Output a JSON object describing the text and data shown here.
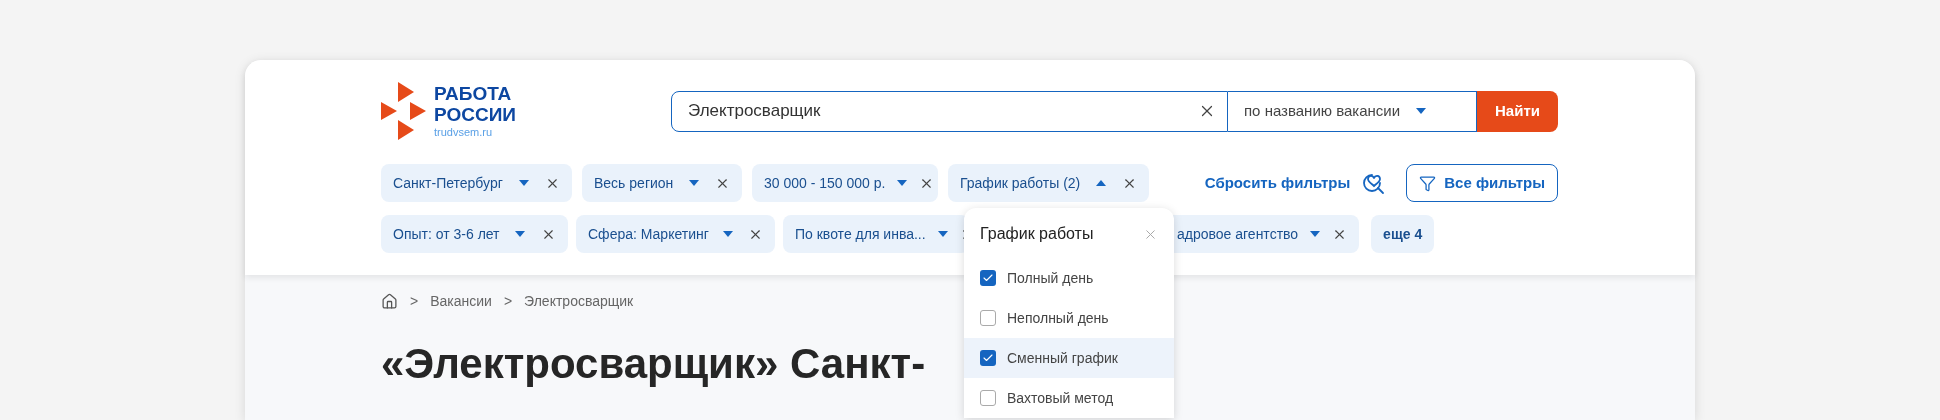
{
  "logo": {
    "line_1": "РАБОТА",
    "line_2": "РОССИИ",
    "domain": "trudvsem.ru"
  },
  "search": {
    "value": "Электросварщик",
    "mode": "по названию вакансии",
    "button": "Найти"
  },
  "filters_row_1": [
    {
      "label": "Санкт-Петербург",
      "expanded": false
    },
    {
      "label": "Весь регион",
      "expanded": false
    },
    {
      "label": "30 000 - 150 000 р.",
      "expanded": false
    },
    {
      "label": "График работы (2)",
      "expanded": true
    }
  ],
  "reset_filters": "Сбросить фильтры",
  "all_filters": "Все фильтры",
  "filters_row_2": [
    {
      "label": "Опыт: от 3-6 лет",
      "expanded": false
    },
    {
      "label": "Сфера: Маркетинг",
      "expanded": false
    },
    {
      "label": "По квоте для инва...",
      "expanded": false
    },
    {
      "label": "адровое агентство",
      "expanded": false
    }
  ],
  "more": "еще 4",
  "dropdown": {
    "title": "График работы",
    "options": [
      {
        "label": "Полный день",
        "checked": true,
        "highlighted": false
      },
      {
        "label": "Неполный день",
        "checked": false,
        "highlighted": false
      },
      {
        "label": "Сменный график",
        "checked": true,
        "highlighted": true
      },
      {
        "label": "Вахтовый метод",
        "checked": false,
        "highlighted": false
      }
    ]
  },
  "breadcrumbs": [
    {
      "separator": ">",
      "label": "Вакансии"
    },
    {
      "separator": ">",
      "label": "Электросварщик"
    }
  ],
  "heading": "«Электросварщик» Санкт-"
}
